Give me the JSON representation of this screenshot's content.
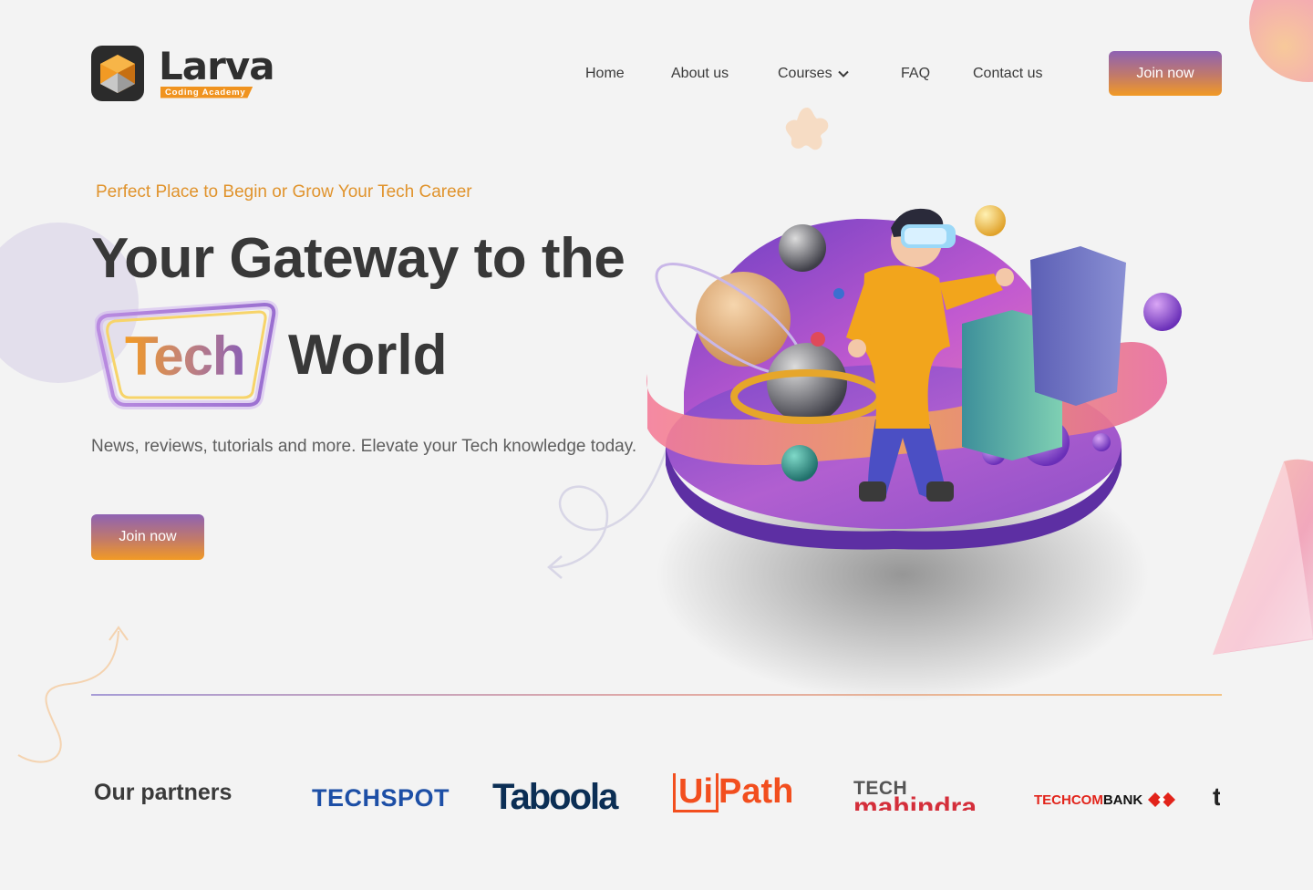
{
  "brand": {
    "name": "Larva",
    "subtitle": "Coding Academy"
  },
  "nav": {
    "items": [
      {
        "label": "Home"
      },
      {
        "label": "About us"
      },
      {
        "label": "Courses"
      },
      {
        "label": "FAQ"
      },
      {
        "label": "Contact us"
      }
    ],
    "cta": "Join now"
  },
  "hero": {
    "tagline": "Perfect Place to Begin or Grow Your Tech Career",
    "headline_line1": "Your Gateway to the",
    "headline_highlight": "Tech",
    "headline_line2": "World",
    "description": "News, reviews, tutorials and more. Elevate your Tech knowledge today.",
    "cta": "Join now"
  },
  "partners": {
    "title": "Our partners",
    "logos": [
      {
        "name": "TECHSPOT"
      },
      {
        "name": "Taboola"
      },
      {
        "name": "UiPath",
        "part1": "Ui",
        "part2": "Path"
      },
      {
        "name": "TECH mahindra",
        "part1": "TECH",
        "part2": "mahindra"
      },
      {
        "name": "TECHCOMBANK",
        "part1": "TECHCOM",
        "part2": "BANK"
      },
      {
        "name": "t"
      }
    ]
  },
  "colors": {
    "background": "#f3f3f3",
    "accent_orange": "#f29a24",
    "accent_purple": "#8e62b3",
    "text_dark": "#383838"
  },
  "icons": {
    "logo": "cube-logo-icon",
    "courses_dropdown": "chevron-down-icon"
  }
}
